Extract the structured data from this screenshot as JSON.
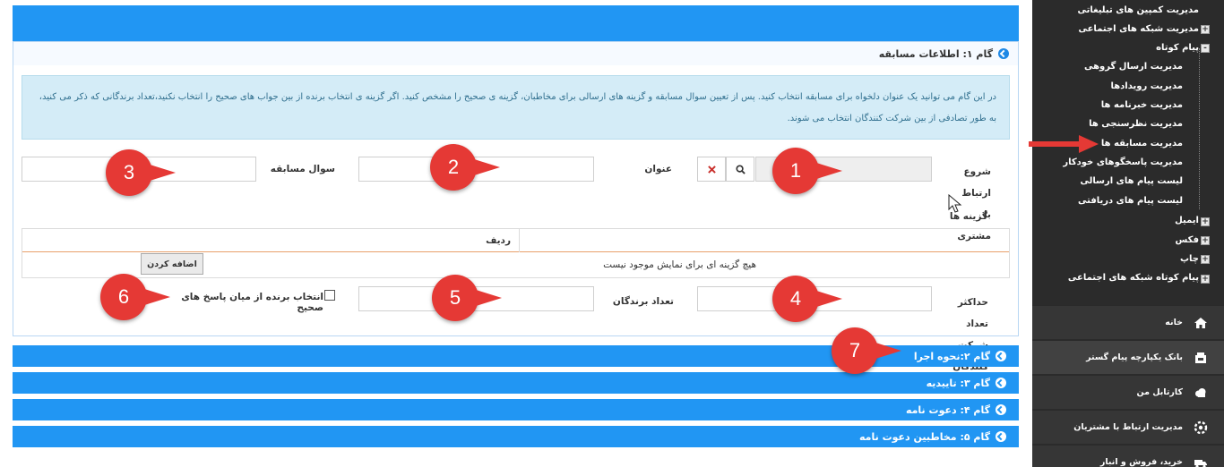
{
  "wizard": {
    "step1_title": "گام ۱: اطلاعات مسابقه",
    "info_text": "در این گام می توانید یک عنوان دلخواه برای مسابقه انتخاب کنید. پس از تعیین سوال مسابقه و گزینه های ارسالی برای مخاطبان، گزینه ی صحیح را مشخص کنید. اگر گزینه ی انتخاب برنده از بین جواب های صحیح را انتخاب نکنید،تعداد برندگانی که ذکر می کنید، به طور تصادفی از بین شرکت کنندگان انتخاب می شوند.",
    "customer_label": "شروع ارتباط با مشتری",
    "title_label": "عنوان",
    "question_label": "سوال مسابقه",
    "options_label": "گزینه ها",
    "table_header_row": "ردیف",
    "table_empty": "هیچ گزینه ای برای نمایش موجود نیست",
    "add_button": "اضافه کردن",
    "max_participants_label": "حداکثر تعداد شرکت کنندگان",
    "winners_count_label": "تعداد برندگان",
    "select_winner_checkbox": "انتخاب برنده از میان پاسخ های صحیح",
    "steps": [
      "گام ۲:نحوه اجرا",
      "گام ۳: تاییدیه",
      "گام ۴: دعوت نامه",
      "گام ۵: مخاطبین دعوت نامه"
    ],
    "search_icon": "search-icon",
    "clear_icon": "close-icon"
  },
  "annotations": [
    "1",
    "2",
    "3",
    "4",
    "5",
    "6",
    "7"
  ],
  "sidebar": {
    "tree": [
      {
        "label": "مدیریت کمپین های تبلیغاتی",
        "box": ""
      },
      {
        "label": "مدیریت شبکه های اجتماعی",
        "box": "+"
      },
      {
        "label": "پیام کوتاه",
        "box": "-"
      },
      {
        "label": "مدیریت ارسال گروهی",
        "box": ""
      },
      {
        "label": "مدیریت رویدادها",
        "box": ""
      },
      {
        "label": "مدیریت خبرنامه ها",
        "box": ""
      },
      {
        "label": "مدیریت نظرسنجی ها",
        "box": ""
      },
      {
        "label": "مدیریت مسابقه ها",
        "box": ""
      },
      {
        "label": "مدیریت پاسخگوهای خودکار",
        "box": ""
      },
      {
        "label": "لیست پیام های ارسالی",
        "box": ""
      },
      {
        "label": "لیست پیام های دریافتی",
        "box": ""
      },
      {
        "label": "ایمیل",
        "box": "+"
      },
      {
        "label": "فکس",
        "box": "+"
      },
      {
        "label": "چاپ",
        "box": "+"
      },
      {
        "label": "پیام کوتاه شبکه های اجتماعی",
        "box": "+"
      }
    ],
    "menu": [
      {
        "label": "خانه",
        "icon": "home-icon"
      },
      {
        "label": "بانک یکپارچه پیام گستر",
        "icon": "bank-icon"
      },
      {
        "label": "کارتابل من",
        "icon": "cloud-icon"
      },
      {
        "label": "مدیریت ارتباط با مشتریان",
        "icon": "gear-icon"
      },
      {
        "label": "خرید، فروش و انبار",
        "icon": "truck-icon"
      }
    ]
  },
  "colors": {
    "accent": "#2196f3",
    "sidebar_bg": "#2b2b2b",
    "annotation_red": "#e53935"
  }
}
